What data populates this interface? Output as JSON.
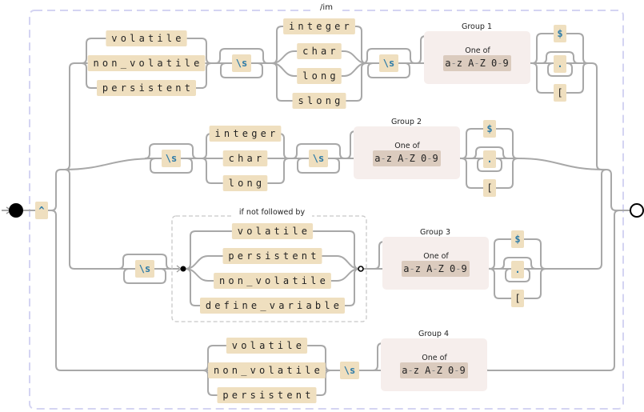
{
  "regex_flags": "/im",
  "anchor": "^",
  "whitespace": "\\s",
  "one_of_label": "One of",
  "char_class": [
    "a",
    "z",
    "A",
    "Z",
    "0",
    "9"
  ],
  "lookahead_label": "if not followed by",
  "row1": {
    "modifiers": [
      "volatile",
      "non_volatile",
      "persistent"
    ],
    "types": [
      "integer",
      "char",
      "long",
      "slong"
    ],
    "group_label": "Group 1",
    "terminators": [
      "$",
      ".",
      "["
    ]
  },
  "row2": {
    "types": [
      "integer",
      "char",
      "long"
    ],
    "group_label": "Group 2",
    "terminators": [
      "$",
      ".",
      "["
    ]
  },
  "row3": {
    "negative_lookahead": [
      "volatile",
      "persistent",
      "non_volatile",
      "define_variable"
    ],
    "group_label": "Group 3",
    "terminators": [
      "$",
      ".",
      "["
    ]
  },
  "row4": {
    "modifiers": [
      "volatile",
      "non_volatile",
      "persistent"
    ],
    "group_label": "Group 4"
  }
}
